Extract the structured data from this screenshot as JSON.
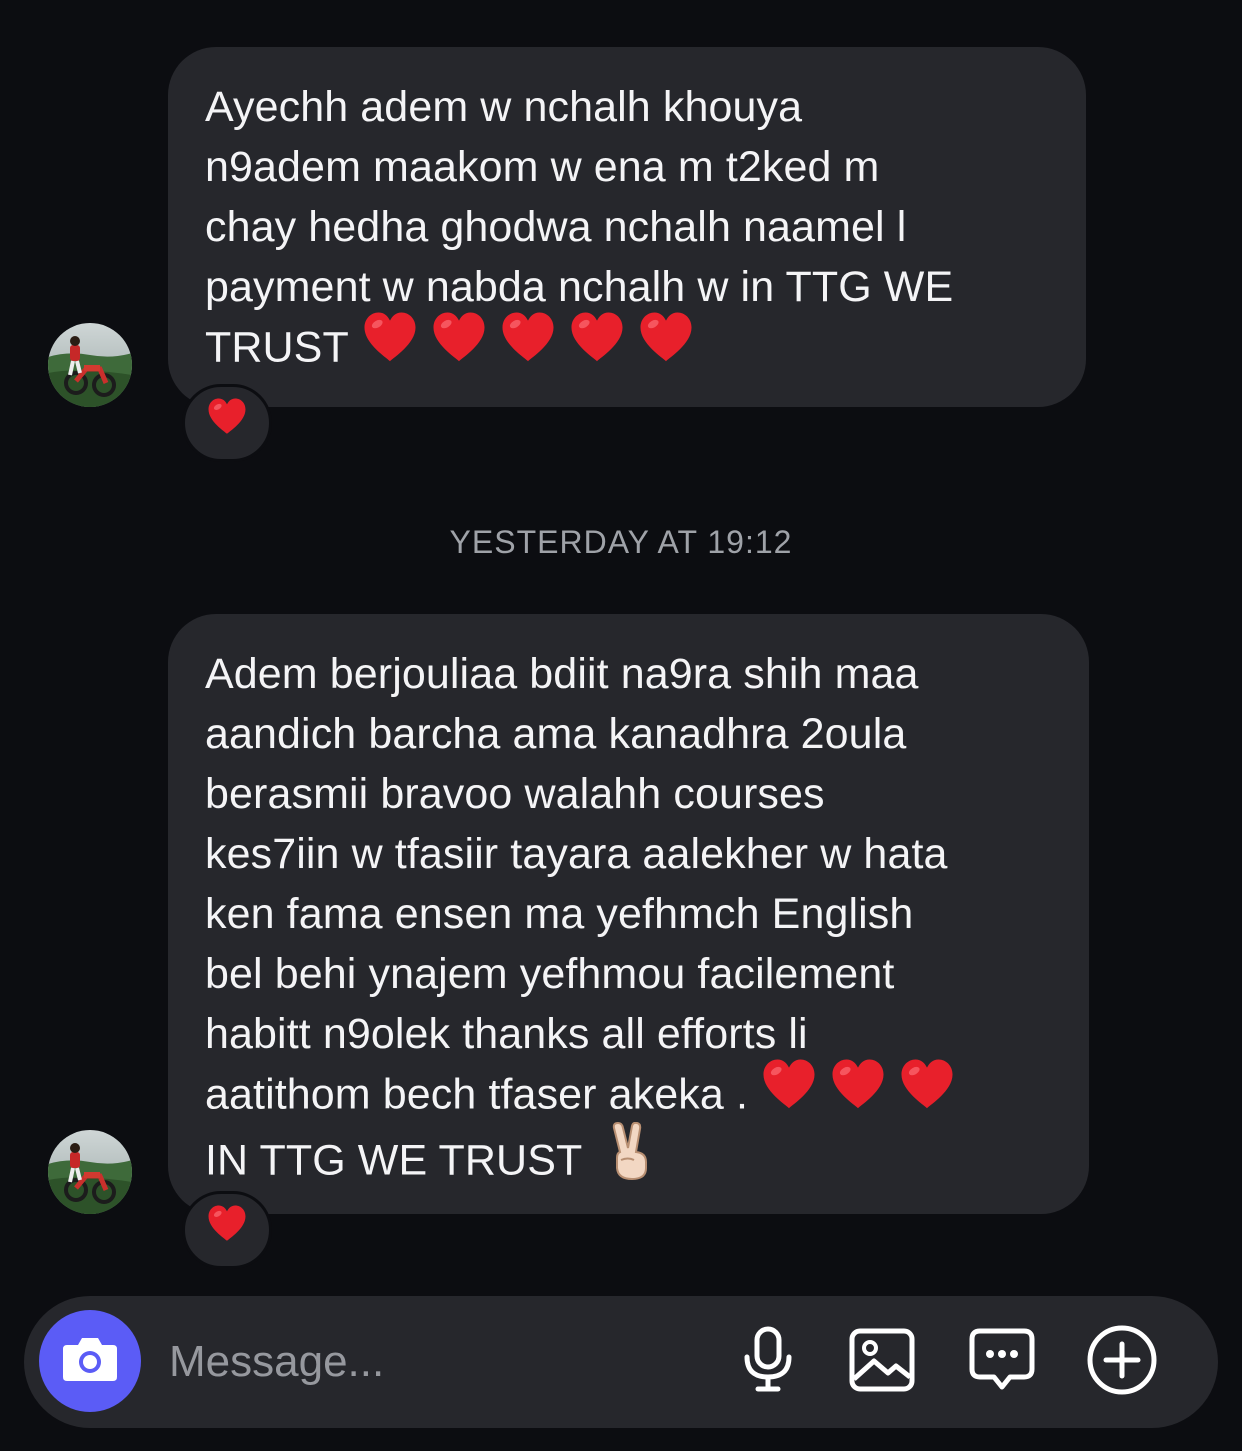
{
  "messages": [
    {
      "lines": [
        "Ayechh adem w nchalh khouya",
        "n9adem maakom w ena m t2ked m",
        "chay hedha ghodwa nchalh naamel l",
        "payment w nabda nchalh w in TTG WE"
      ],
      "last_line_text": "TRUST",
      "trailing_emoji": [
        "❤️",
        "❤️",
        "❤️",
        "❤️",
        "❤️"
      ],
      "reaction": "❤️"
    },
    {
      "lines": [
        "Adem berjouliaa bdiit na9ra shih maa",
        "aandich barcha ama kanadhra 2oula",
        "berasmii bravoo walahh courses",
        "kes7iin w tfasiir tayara aalekher w hata",
        "ken fama ensen ma yefhmch English",
        "bel behi ynajem yefhmou facilement",
        "habitt n9olek thanks all efforts li"
      ],
      "emoji_line_text": "aatithom bech tfaser akeka .",
      "emoji_line_emoji": [
        "❤️",
        "❤️",
        "❤️"
      ],
      "last_line_text": "IN TTG WE TRUST",
      "last_line_emoji": "✌🏻",
      "reaction": "❤️"
    }
  ],
  "timestamp": "YESTERDAY AT 19:12",
  "composer": {
    "placeholder": "Message...",
    "camera_icon": "camera-icon",
    "tools": [
      "microphone-icon",
      "gallery-icon",
      "chat-bubble-icon",
      "plus-circle-icon"
    ]
  },
  "colors": {
    "background": "#0c0d11",
    "bubble": "#26272c",
    "accent": "#5b5cf6",
    "heart": "#e8202b"
  }
}
